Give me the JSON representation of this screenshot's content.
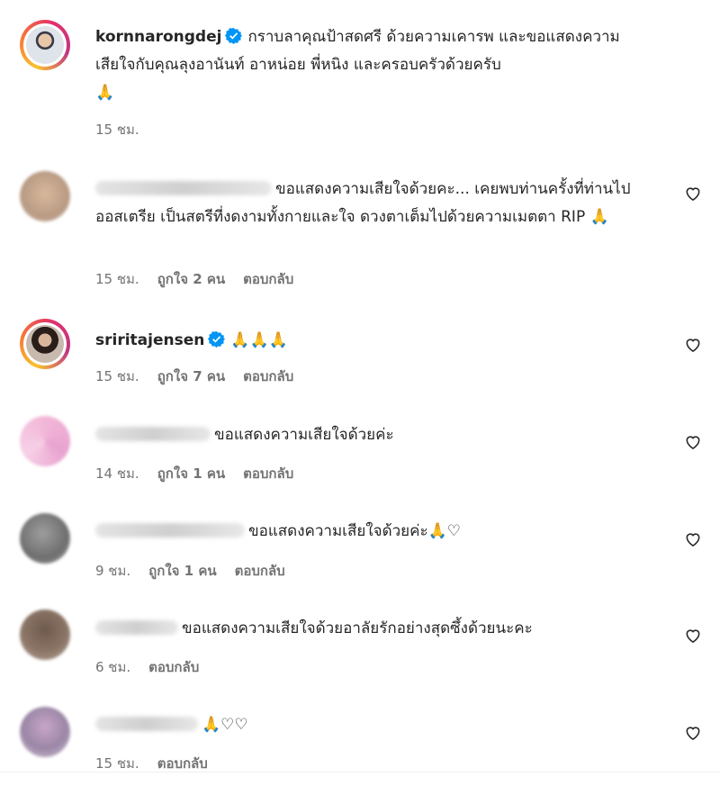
{
  "caption": {
    "username": "kornnarongdej",
    "text": "กราบลาคุณป้าสดศรี ด้วยความเคารพ และขอแสดงความเสียใจกับคุณลุงอานันท์ อาหน่อย พี่หนิง และครอบครัวด้วยครับ",
    "emoji": "🙏",
    "time": "15 ชม."
  },
  "comments": [
    {
      "username": "",
      "text": "ขอแสดงความเสียใจด้วยคะ... เคยพบท่านครั้งที่ท่านไปออสเตรีย เป็นสตรีที่งดงามทั้งกายและใจ ดวงตาเต็มไปด้วยความเมตตา RIP",
      "emoji": "🙏",
      "time": "15 ชม.",
      "likes": "ถูกใจ 2 คน",
      "reply": "ตอบกลับ"
    },
    {
      "username": "sriritajensen",
      "text": "",
      "emoji": "🙏🙏🙏",
      "time": "15 ชม.",
      "likes": "ถูกใจ 7 คน",
      "reply": "ตอบกลับ"
    },
    {
      "username": "",
      "text": "ขอแสดงความเสียใจด้วยค่ะ",
      "emoji": "",
      "time": "14 ชม.",
      "likes": "ถูกใจ 1 คน",
      "reply": "ตอบกลับ"
    },
    {
      "username": "",
      "text": "ขอแสดงความเสียใจด้วยค่ะ",
      "emoji": "🙏♡",
      "time": "9 ชม.",
      "likes": "ถูกใจ 1 คน",
      "reply": "ตอบกลับ"
    },
    {
      "username": "",
      "text": "ขอแสดงความเสียใจด้วยอาลัยรักอย่างสุดซึ้งด้วยนะคะ",
      "emoji": "",
      "time": "6 ชม.",
      "likes": "",
      "reply": "ตอบกลับ"
    },
    {
      "username": "",
      "text": "",
      "emoji": "🙏♡♡",
      "time": "15 ชม.",
      "likes": "",
      "reply": "ตอบกลับ"
    }
  ],
  "colors": {
    "verified": "#0095f6",
    "meta_text": "#737373",
    "text": "#262626"
  },
  "icons": {
    "like": "heart-outline-icon",
    "verified": "verified-badge-icon"
  }
}
